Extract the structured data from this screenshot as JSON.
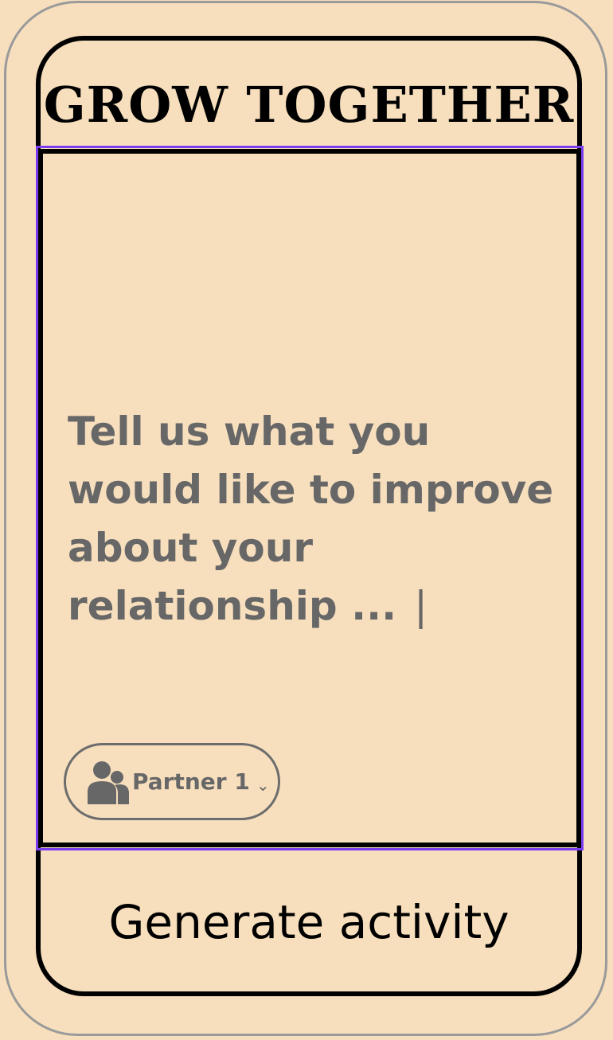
{
  "app": {
    "title": "GROW TOGETHER"
  },
  "input": {
    "prompt": "Tell us what you would like to improve about your relationship ...",
    "cursor": "|"
  },
  "partner_selector": {
    "icon": "users-icon",
    "label": "Partner 1",
    "chevron": "⌄"
  },
  "actions": {
    "generate_label": "Generate activity"
  },
  "colors": {
    "background": "#f7dfbe",
    "border": "#000000",
    "focus_outline": "#7b3cf0",
    "muted_text": "#676767"
  }
}
